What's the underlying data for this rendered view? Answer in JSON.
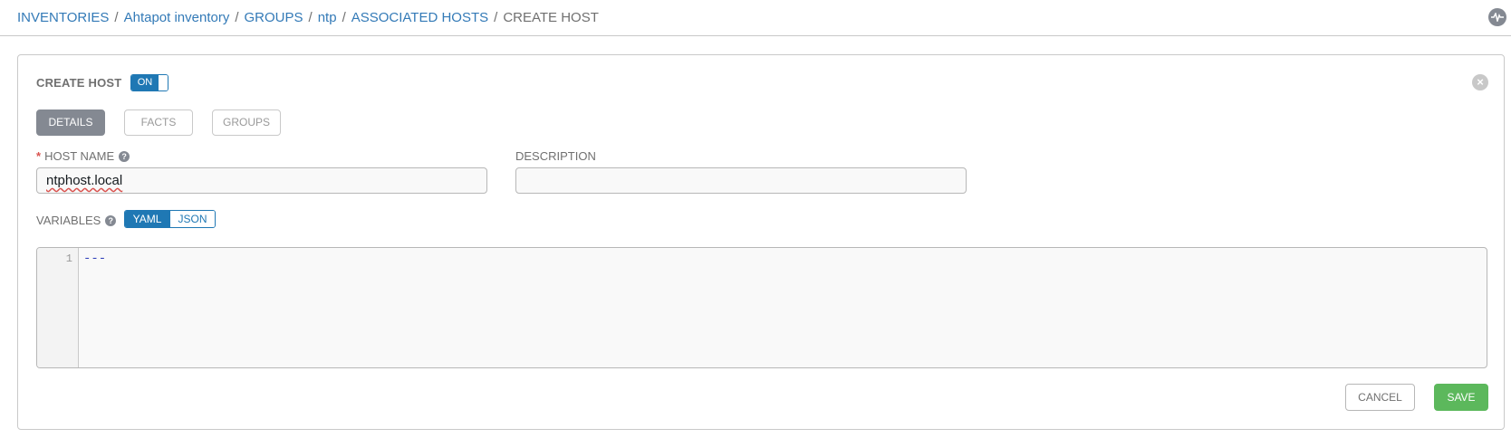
{
  "breadcrumb": {
    "links": [
      "INVENTORIES",
      "Ahtapot inventory",
      "GROUPS",
      "ntp",
      "ASSOCIATED HOSTS"
    ],
    "separator": "/",
    "current": "CREATE HOST"
  },
  "header": {
    "activity_icon": "activity-stream-icon"
  },
  "panel": {
    "title": "CREATE HOST",
    "toggle_label": "ON",
    "toggle_state": true,
    "close_icon": "close-circle-icon"
  },
  "tabs": [
    {
      "label": "DETAILS",
      "active": true
    },
    {
      "label": "FACTS",
      "active": false
    },
    {
      "label": "GROUPS",
      "active": false
    }
  ],
  "form": {
    "required_marker": "*",
    "host_name": {
      "label": "HOST NAME",
      "value": "ntphost.local",
      "help_icon": "question-circle-icon"
    },
    "description": {
      "label": "DESCRIPTION",
      "value": ""
    },
    "variables": {
      "label": "VARIABLES",
      "help_icon": "question-circle-icon",
      "formats": [
        "YAML",
        "JSON"
      ],
      "selected_format": "YAML",
      "line_number": "1",
      "content": "---"
    }
  },
  "actions": {
    "cancel_label": "CANCEL",
    "save_label": "SAVE"
  },
  "colors": {
    "link": "#337ab7",
    "accent": "#1f78b4",
    "save": "#5cb85c",
    "required": "#d9534f"
  }
}
